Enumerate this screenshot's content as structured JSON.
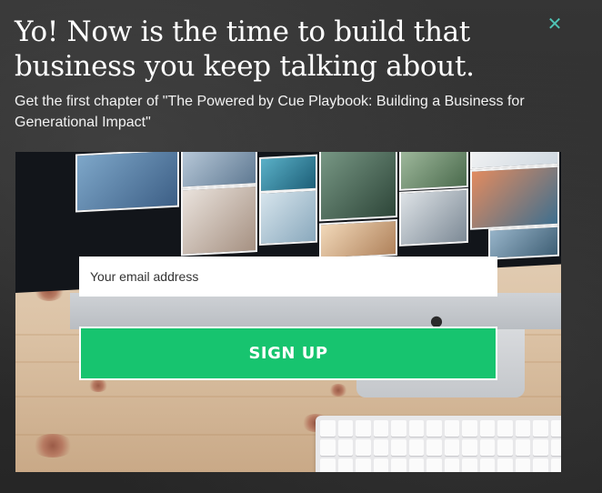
{
  "popup": {
    "headline": "Yo! Now is the time to build that business you keep talking about.",
    "subhead": "Get the first chapter of \"The Powered by Cue Playbook: Building a Business for Generational Impact\"",
    "close_icon": "close-icon",
    "email_placeholder": "Your email address",
    "signup_label": "SIGN UP"
  },
  "colors": {
    "accent_close": "#4fc3b5",
    "signup_button": "#17c46f",
    "overlay": "#2b2b2b"
  }
}
